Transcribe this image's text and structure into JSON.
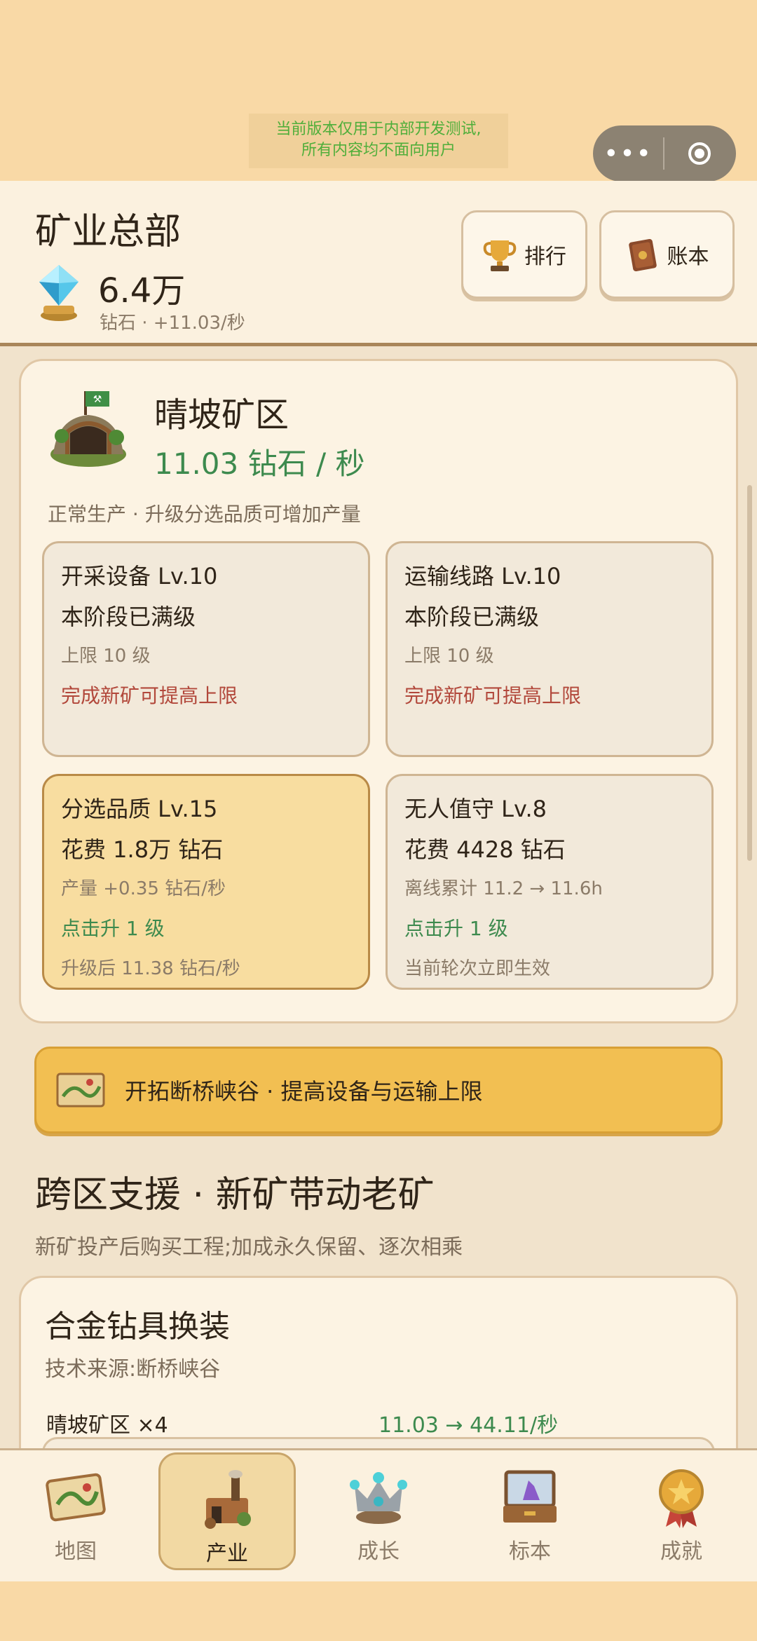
{
  "system": {
    "dev_notice_line1": "当前版本仅用于内部开发测试,",
    "dev_notice_line2": "所有内容均不面向用户",
    "capsule_more": "•••"
  },
  "header": {
    "title": "矿业总部",
    "gem_amount": "6.4万",
    "gem_sub": "钻石 · +11.03/秒",
    "rank_label": "排行",
    "ledger_label": "账本"
  },
  "mine": {
    "name": "晴坡矿区",
    "rate": "11.03 钻石 / 秒",
    "status": "正常生产 · 升级分选品质可增加产量",
    "tiles": [
      {
        "title": "开采设备 Lv.10",
        "main": "本阶段已满级",
        "sub": "上限 10 级",
        "note": "完成新矿可提高上限",
        "foot": ""
      },
      {
        "title": "运输线路 Lv.10",
        "main": "本阶段已满级",
        "sub": "上限 10 级",
        "note": "完成新矿可提高上限",
        "foot": ""
      },
      {
        "title": "分选品质 Lv.15",
        "main": "花费 1.8万 钻石",
        "sub": "产量 +0.35 钻石/秒",
        "note": "点击升 1 级",
        "foot": "升级后 11.38 钻石/秒"
      },
      {
        "title": "无人值守 Lv.8",
        "main": "花费 4428 钻石",
        "sub": "离线累计 11.2 → 11.6h",
        "note": "点击升 1 级",
        "foot": "当前轮次立即生效"
      }
    ]
  },
  "banner": {
    "text": "开拓断桥峡谷 · 提高设备与运输上限"
  },
  "support": {
    "section_title": "跨区支援 · 新矿带动老矿",
    "section_sub": "新矿投产后购买工程;加成永久保留、逐次相乘",
    "card_title": "合金钻具换装",
    "card_source": "技术来源:断桥峡谷",
    "mine_line": "晴坡矿区 ×4",
    "rate_line": "11.03 → 44.11/秒"
  },
  "nav": {
    "items": [
      {
        "label": "地图",
        "icon": "map-icon"
      },
      {
        "label": "产业",
        "icon": "factory-icon"
      },
      {
        "label": "成长",
        "icon": "crown-icon"
      },
      {
        "label": "标本",
        "icon": "specimen-box-icon"
      },
      {
        "label": "成就",
        "icon": "medal-icon"
      }
    ],
    "active": "产业"
  },
  "colors": {
    "accent_green": "#3d8a4e",
    "warn_red": "#b2483b",
    "banner_gold": "#f2bf52",
    "page_peach": "#f9d9a6"
  }
}
